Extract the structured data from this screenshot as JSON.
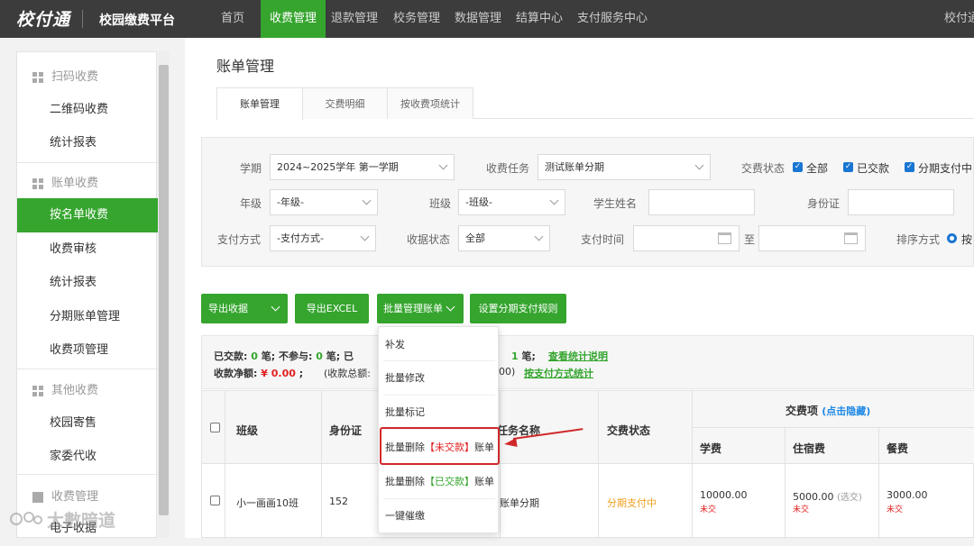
{
  "topbar": {
    "logo": "校付通",
    "platform": "校园缴费平台",
    "nav": [
      "首页",
      "收费管理",
      "退款管理",
      "校务管理",
      "数据管理",
      "结算中心",
      "支付服务中心"
    ],
    "active_nav": "收费管理",
    "right_text": "校付通"
  },
  "sidebar": {
    "groups": [
      {
        "label": "扫码收费",
        "icon": "grid-icon",
        "items": [
          "二维码收费",
          "统计报表"
        ]
      },
      {
        "label": "账单收费",
        "icon": "grid-icon",
        "items": [
          "按名单收费",
          "收费审核",
          "统计报表",
          "分期账单管理",
          "收费项管理"
        ]
      },
      {
        "label": "其他收费",
        "icon": "grid-icon",
        "items": [
          "校园寄售",
          "家委代收"
        ]
      },
      {
        "label": "收费管理",
        "icon": "download-icon",
        "items": [
          "电子收据"
        ]
      }
    ],
    "active_item": "按名单收费"
  },
  "page": {
    "title": "账单管理",
    "tabs": [
      "账单管理",
      "交费明细",
      "按收费项统计"
    ],
    "active_tab": "账单管理"
  },
  "filters": {
    "term_label": "学期",
    "term_value": "2024~2025学年 第一学期",
    "task_label": "收费任务",
    "task_value": "测试账单分期",
    "status_label": "交费状态",
    "status_options": [
      "全部",
      "已交款",
      "分期支付中"
    ],
    "grade_label": "年级",
    "grade_value": "-年级-",
    "class_label": "班级",
    "class_value": "-班级-",
    "student_label": "学生姓名",
    "student_value": "",
    "id_label": "身份证",
    "id_value": "",
    "pay_method_label": "支付方式",
    "pay_method_value": "-支付方式-",
    "receipt_label": "收据状态",
    "receipt_value": "全部",
    "pay_time_label": "支付时间",
    "to_label": "至",
    "sort_label": "排序方式",
    "sort_value": "按"
  },
  "buttons": {
    "export_receipt": "导出收据",
    "export_excel": "导出EXCEL",
    "batch_manage": "批量管理账单",
    "set_installment": "设置分期支付规则"
  },
  "summary": {
    "paid_label": "已交款:",
    "paid_count": "0",
    "unit": "笔;",
    "not_joined_label": "不参与:",
    "not_joined_count": "0",
    "partial_label": "已",
    "partial_count": "1",
    "stats_link": "查看统计说明",
    "net_label": "收款净额:",
    "net_value": "¥ 0.00",
    "net_sep": ";",
    "total_prefix": "(收款总额:",
    "total_suffix": "00)",
    "paymethod_link": "按支付方式统计"
  },
  "dropdown": {
    "items": [
      "补发",
      "批量修改",
      "批量标记",
      "批量删除【未交款】账单",
      "批量删除【已交款】账单",
      "一键催缴"
    ],
    "item4_prefix": "批量删除",
    "item4_tag": "【未交款】",
    "item4_suffix": "账单",
    "item5_prefix": "批量删除",
    "item5_tag": "【已交款】",
    "item5_suffix": "账单"
  },
  "table": {
    "headers": {
      "class": "班级",
      "id_card": "身份证",
      "task_name": "任务名称",
      "status": "交费状态",
      "fee_items": "交费项",
      "hide_link": "(点击隐藏)",
      "tuition": "学费",
      "lodging": "住宿费",
      "meal": "餐费"
    },
    "rows": [
      {
        "class": "小一画画10班",
        "id_card": "152",
        "task_name": "账单分期",
        "status": "分期支付中",
        "tuition": "10000.00",
        "tuition_state": "未交",
        "lodging": "5000.00",
        "lodging_note": "(选交)",
        "lodging_state": "未交",
        "meal": "3000.00",
        "meal_state": "未交"
      }
    ]
  },
  "watermark": "大數暗道",
  "colors": {
    "brand_green": "#35a52e",
    "topbar": "#3c3c3c",
    "annotation_red": "#d0282a",
    "status_orange": "#f0a020"
  }
}
